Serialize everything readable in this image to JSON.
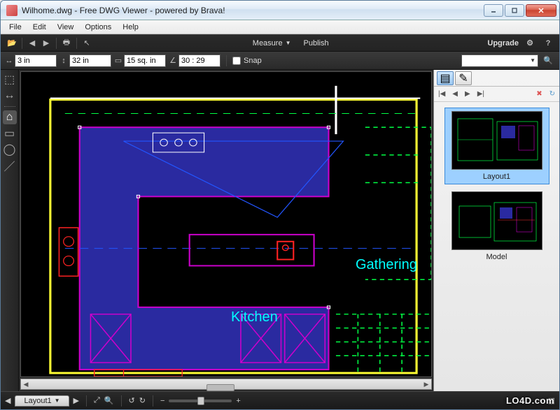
{
  "window": {
    "title": "Wilhome.dwg - Free DWG Viewer - powered by Brava!"
  },
  "menubar": {
    "items": [
      "File",
      "Edit",
      "View",
      "Options",
      "Help"
    ]
  },
  "toolbar1": {
    "center": {
      "measure": "Measure",
      "publish": "Publish"
    },
    "right": {
      "upgrade": "Upgrade"
    }
  },
  "toolbar2": {
    "width_value": "3 in",
    "height_value": "32 in",
    "area_value": "15 sq. in",
    "angle_value": "30 : 29",
    "snap_label": "Snap",
    "snap_checked": false,
    "combo_value": ""
  },
  "canvas": {
    "labels": {
      "kitchen": "Kitchen",
      "gathering": "Gathering"
    },
    "colors": {
      "bg": "#000000",
      "wall": "#ffff33",
      "outline": "#cc00cc",
      "counter": "#2a2aa0",
      "fixture": "#ff2222",
      "text": "#00ffff",
      "green": "#00ff44",
      "white": "#ffffff",
      "blue": "#2255ff"
    }
  },
  "rightpanel": {
    "tabs": [
      "pages",
      "markups"
    ],
    "nav": {
      "first": "|◀",
      "prev": "◀",
      "next": "▶",
      "last": "▶|"
    },
    "thumbs": [
      {
        "label": "Layout1",
        "selected": true
      },
      {
        "label": "Model",
        "selected": false
      }
    ]
  },
  "bottombar": {
    "tab_label": "Layout1"
  },
  "watermark": "LO4D.com"
}
